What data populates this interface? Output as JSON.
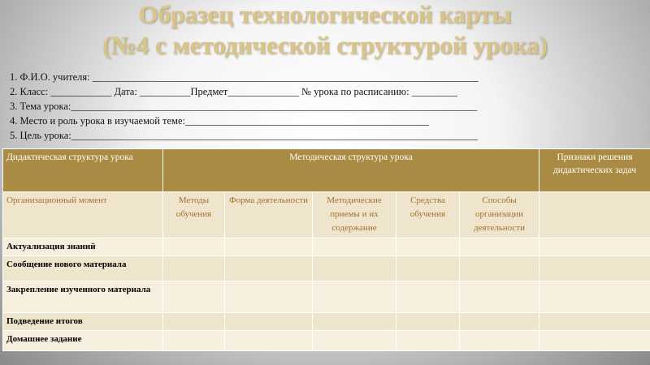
{
  "title": {
    "line1": "Образец технологической карты",
    "line2": "(№4 с методической структурой урока)"
  },
  "fields": [
    "1. Ф.И.О. учителя: ____________________________________________________________________________",
    "2. Класс: ____________  Дата: __________Предмет______________  № урока по расписанию: _________",
    "3. Тема урока:________________________________________________________________________________",
    "4. Место и роль урока в изучаемой теме:________________________________________________",
    "5. Цель урока:________________________________________________________________________________"
  ],
  "table": {
    "header": {
      "col1": "Дидактическая структура урока",
      "col2": "Методическая структура урока",
      "col3": "Признаки решения дидактических задач"
    },
    "subheader": {
      "label": "Организационный момент",
      "cols": [
        "Методы обучения",
        "Форма деятельности",
        "Методические приемы и их содержание",
        "Средства обучения",
        "Способы организации деятельности"
      ]
    },
    "rows": [
      "Актуализация знаний",
      "Сообщение нового материала",
      "Закрепление изученного материала",
      "Подведение итогов",
      "Домашнее задание"
    ]
  }
}
